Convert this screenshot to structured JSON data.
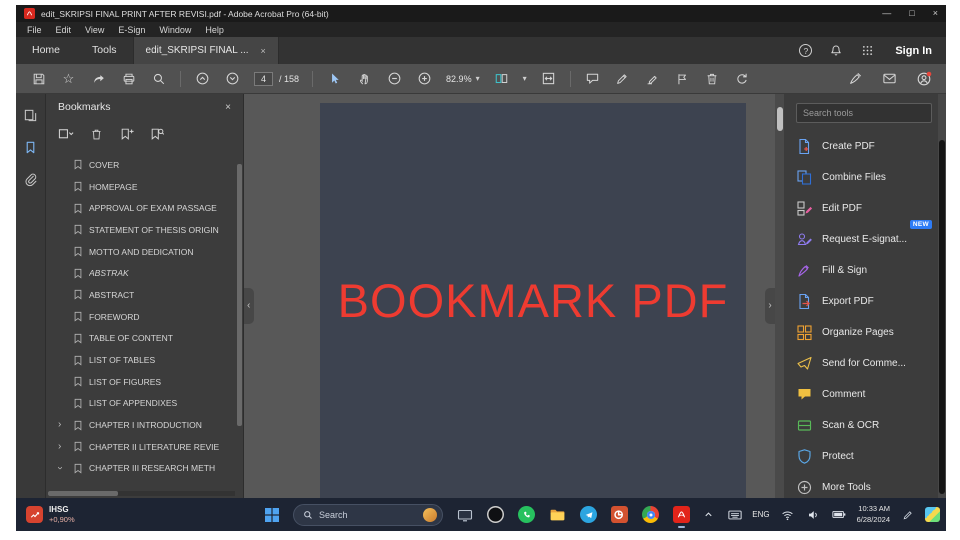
{
  "window": {
    "title": "edit_SKRIPSI FINAL PRINT AFTER REVISI.pdf - Adobe Acrobat Pro (64-bit)"
  },
  "icons": {
    "minimize": "—",
    "maximize": "□",
    "close": "×",
    "help": "?",
    "dropdown": "▾",
    "chevron": "›",
    "star": "☆"
  },
  "menu": {
    "items": [
      "File",
      "Edit",
      "View",
      "E-Sign",
      "Window",
      "Help"
    ]
  },
  "tabs": {
    "home": "Home",
    "tools": "Tools",
    "document": "edit_SKRIPSI FINAL ...",
    "sign_in": "Sign In"
  },
  "toolbar": {
    "page_current": "4",
    "page_total": "/ 158",
    "zoom": "82.9%"
  },
  "bookmarks": {
    "title": "Bookmarks",
    "items": [
      {
        "label": "COVER"
      },
      {
        "label": "HOMEPAGE"
      },
      {
        "label": "APPROVAL OF EXAM PASSAGE"
      },
      {
        "label": "STATEMENT OF THESIS ORIGIN"
      },
      {
        "label": "MOTTO AND DEDICATION"
      },
      {
        "label": "ABSTRAK"
      },
      {
        "label": "ABSTRACT"
      },
      {
        "label": "FOREWORD"
      },
      {
        "label": "TABLE OF CONTENT"
      },
      {
        "label": "LIST OF TABLES"
      },
      {
        "label": "LIST OF FIGURES"
      },
      {
        "label": "LIST OF APPENDIXES"
      },
      {
        "label": "CHAPTER I INTRODUCTION"
      },
      {
        "label": "CHAPTER II LITERATURE REVIE"
      },
      {
        "label": "CHAPTER III RESEARCH METH"
      }
    ]
  },
  "document": {
    "watermark": "BOOKMARK PDF"
  },
  "tools_panel": {
    "search_placeholder": "Search tools",
    "new_badge": "NEW",
    "items": [
      {
        "label": "Create PDF"
      },
      {
        "label": "Combine Files"
      },
      {
        "label": "Edit PDF"
      },
      {
        "label": "Request E-signat..."
      },
      {
        "label": "Fill & Sign"
      },
      {
        "label": "Export PDF"
      },
      {
        "label": "Organize Pages"
      },
      {
        "label": "Send for Comme..."
      },
      {
        "label": "Comment"
      },
      {
        "label": "Scan & OCR"
      },
      {
        "label": "Protect"
      },
      {
        "label": "More Tools"
      }
    ]
  },
  "taskbar": {
    "widget_line1": "IHSG",
    "widget_line2": "+0,90%",
    "search_label": "Search",
    "language": "ENG",
    "time": "10:33 AM",
    "date": "6/28/2024"
  }
}
